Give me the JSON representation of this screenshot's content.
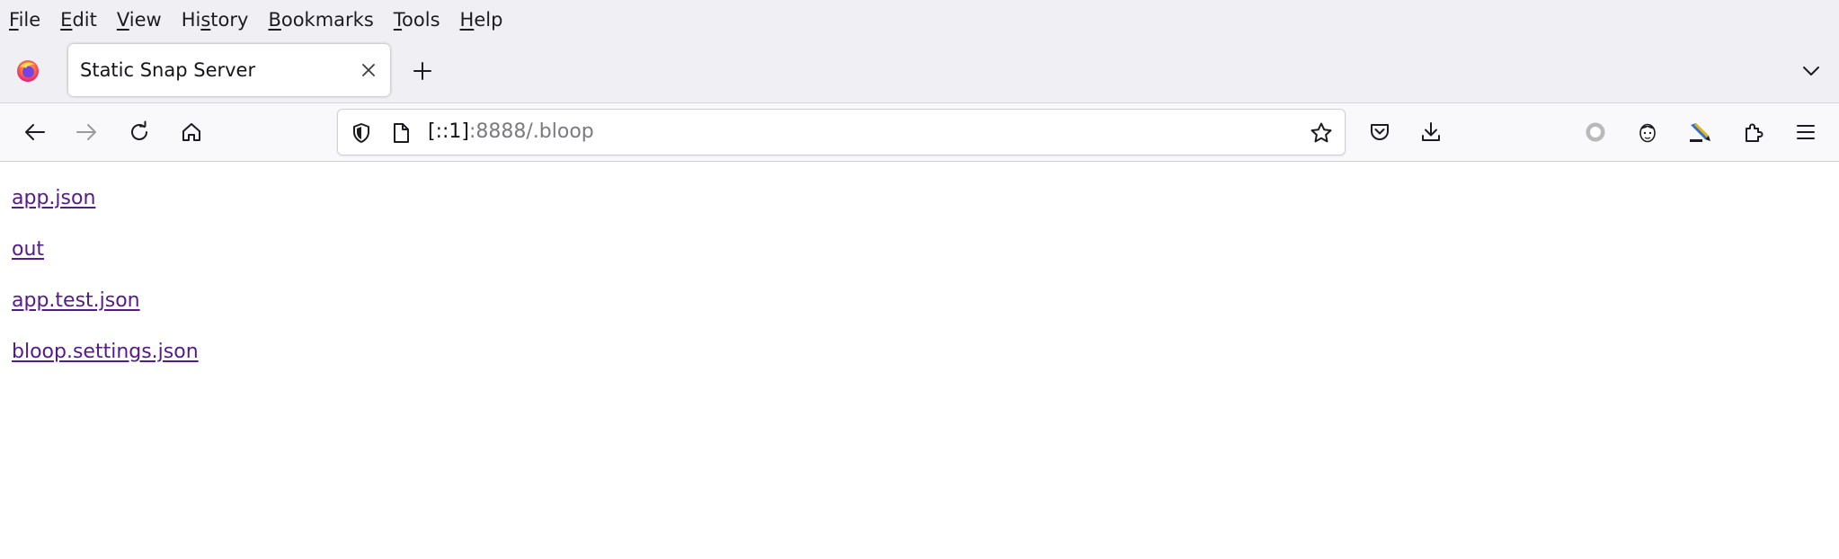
{
  "menubar": {
    "items": [
      {
        "pre": "",
        "key": "F",
        "post": "ile"
      },
      {
        "pre": "",
        "key": "E",
        "post": "dit"
      },
      {
        "pre": "",
        "key": "V",
        "post": "iew"
      },
      {
        "pre": "Hi",
        "key": "s",
        "post": "tory"
      },
      {
        "pre": "",
        "key": "B",
        "post": "ookmarks"
      },
      {
        "pre": "",
        "key": "T",
        "post": "ools"
      },
      {
        "pre": "",
        "key": "H",
        "post": "elp"
      }
    ]
  },
  "tab": {
    "title": "Static Snap Server"
  },
  "urlbar": {
    "host": "[::1]",
    "path": ":8888/.bloop"
  },
  "content": {
    "links": [
      {
        "label": "app.json"
      },
      {
        "label": "out"
      },
      {
        "label": "app.test.json"
      },
      {
        "label": "bloop.settings.json"
      }
    ]
  },
  "colors": {
    "chrome_bg": "#f0f0f4",
    "toolbar_bg": "#f9f9fb",
    "visited_link": "#551a8b",
    "accent_blue": "#0061e0"
  },
  "icons": {
    "browser_logo": "firefox-logo-icon",
    "close": "close-icon",
    "new_tab": "plus-icon",
    "tab_list": "chevron-down-icon",
    "back": "back-arrow-icon",
    "forward": "forward-arrow-icon",
    "reload": "reload-icon",
    "home": "home-icon",
    "tracking": "shield-icon",
    "page": "page-icon",
    "bookmark": "star-icon",
    "pocket": "pocket-icon",
    "downloads": "download-icon",
    "extension_1": "circle-record-icon",
    "extension_2": "face-avatar-icon",
    "extension_3": "pencil-icon",
    "extensions": "puzzle-icon",
    "menu": "hamburger-menu-icon"
  }
}
